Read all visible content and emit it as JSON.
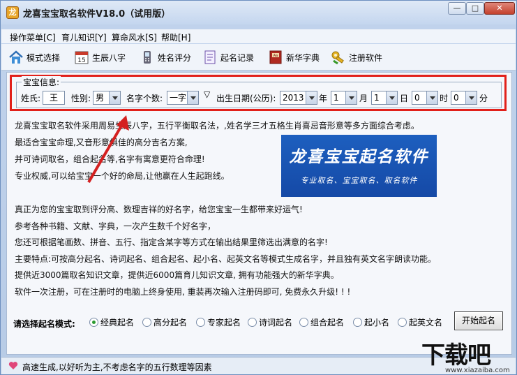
{
  "window": {
    "title": "龙喜宝宝取名软件V18.0（试用版）",
    "controls": {
      "minimize": "—",
      "maximize": "□",
      "close": "✕"
    }
  },
  "menu": [
    {
      "label": "操作菜单[C]"
    },
    {
      "label": "育儿知识[Y]"
    },
    {
      "label": "算命风水[S]"
    },
    {
      "label": "帮助[H]"
    }
  ],
  "toolbar": [
    {
      "label": "模式选择",
      "icon": "home-icon"
    },
    {
      "label": "生辰八字",
      "icon": "calendar-icon"
    },
    {
      "label": "姓名评分",
      "icon": "phone-icon"
    },
    {
      "label": "起名记录",
      "icon": "notebook-icon"
    },
    {
      "label": "新华字典",
      "icon": "dictionary-icon"
    },
    {
      "label": "注册软件",
      "icon": "key-icon"
    }
  ],
  "baby_info": {
    "group_title": "宝宝信息:",
    "surname_label": "姓氏:",
    "surname_value": "王",
    "gender_label": "性别:",
    "gender_value": "男",
    "name_len_label": "名字个数:",
    "name_len_value": "一字",
    "name_len_marker": "▽",
    "birth_label": "出生日期(公历):",
    "year_value": "2013",
    "year_unit": "年",
    "month_value": "1",
    "month_unit": "月",
    "day_value": "1",
    "day_unit": "日",
    "hour_value": "0",
    "hour_unit": "时",
    "minute_value": "0",
    "minute_unit": "分"
  },
  "description": [
    "龙喜宝宝取名软件采用周易生辰八字，五行平衡取名法，,姓名学三才五格生肖喜忌音形意等多方面综合考虑。",
    "最适合宝宝命理,又音形意俱佳的高分吉名方案,",
    "并可诗词取名，组合起名等,名字有寓意更符合命理!",
    "专业权威,可以给宝宝一个好的命局,让他赢在人生起跑线。",
    "真正为您的宝宝取到评分高、数理吉祥的好名字，给您宝宝一生都带来好运气!",
    "参考各种书籍、文献、字典，一次产生数千个好名字，",
    "您还可根据笔画数、拼音、五行、指定含某字等方式在输出结果里筛选出满意的名字!",
    "主要特点:可按高分起名、诗词起名、组合起名、起小名、起英文名等模式生成名字，并且独有英文名字朗读功能。",
    "提供近3000篇取名知识文章，提供近6000篇育儿知识文章, 拥有功能强大的新华字典。",
    "软件一次注册，可在注册时的电脑上终身使用, 重装再次输入注册码即可, 免费永久升级! ! !"
  ],
  "banner": {
    "title": "龙喜宝宝起名软件",
    "subtitle": "专业取名、宝宝取名、取名软件",
    "bg_color": "#1a55b3"
  },
  "mode": {
    "label": "请选择起名模式:",
    "options": [
      {
        "label": "经典起名",
        "selected": true
      },
      {
        "label": "高分起名",
        "selected": false
      },
      {
        "label": "专家起名",
        "selected": false
      },
      {
        "label": "诗词起名",
        "selected": false
      },
      {
        "label": "组合起名",
        "selected": false
      },
      {
        "label": "起小名",
        "selected": false
      },
      {
        "label": "起英文名",
        "selected": false
      }
    ],
    "start_button": "开始起名"
  },
  "status": {
    "text": "高速生成,以好听为主,不考虑名字的五行数理等因素"
  },
  "watermark": {
    "main": "下载吧",
    "sub": "www.xiazaiba.com"
  },
  "colors": {
    "highlight_box": "#e1201a",
    "radio_selected": "#2a9a30"
  }
}
